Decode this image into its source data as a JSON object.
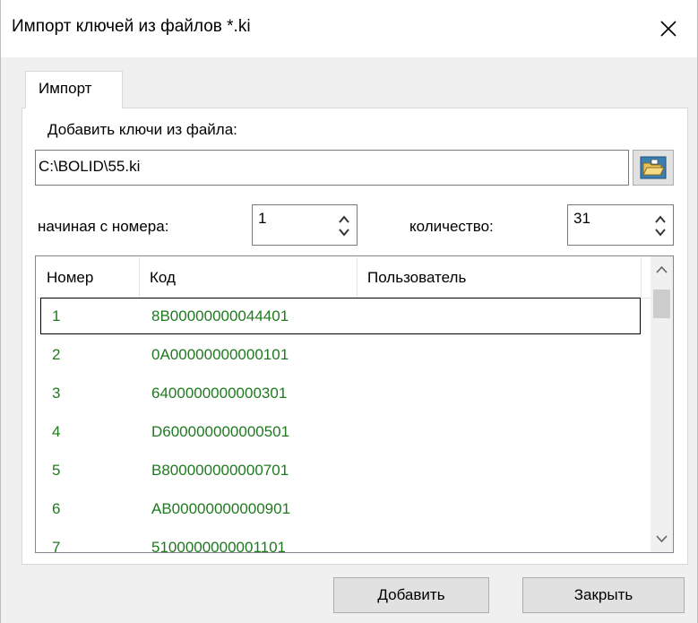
{
  "window": {
    "title": "Импорт ключей из файлов *.ki"
  },
  "tabs": [
    {
      "label": "Импорт"
    }
  ],
  "file": {
    "label": "Добавить ключи из файла:",
    "value": "C:\\BOLID\\55.ki"
  },
  "start": {
    "label": "начиная с номера:",
    "value": "1"
  },
  "count": {
    "label": "количество:",
    "value": "31"
  },
  "table": {
    "columns": [
      "Номер",
      "Код",
      "Пользователь"
    ],
    "rows": [
      {
        "num": "1",
        "code": "8B00000000044401",
        "user": ""
      },
      {
        "num": "2",
        "code": "0A00000000000101",
        "user": ""
      },
      {
        "num": "3",
        "code": "6400000000000301",
        "user": ""
      },
      {
        "num": "4",
        "code": "D600000000000501",
        "user": ""
      },
      {
        "num": "5",
        "code": "B800000000000701",
        "user": ""
      },
      {
        "num": "6",
        "code": "AB00000000000901",
        "user": ""
      },
      {
        "num": "7",
        "code": "5100000000001101",
        "user": ""
      }
    ]
  },
  "buttons": {
    "add": "Добавить",
    "close": "Закрыть"
  },
  "icons": {
    "close": "close-icon",
    "browse": "folder-open-icon"
  },
  "colors": {
    "row_text": "#1f7a1f"
  }
}
